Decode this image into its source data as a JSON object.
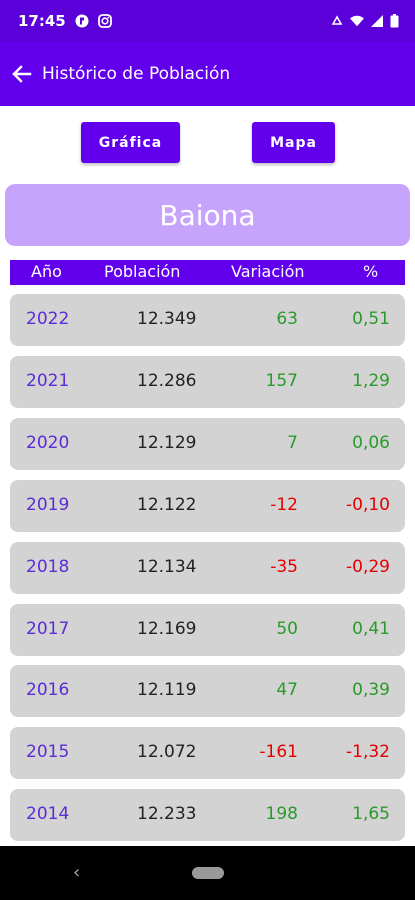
{
  "status_bar": {
    "time": "17:45"
  },
  "app_bar": {
    "title": "Histórico de Población"
  },
  "buttons": {
    "grafica": "Gráfica",
    "mapa": "Mapa"
  },
  "place": "Baiona",
  "table": {
    "headers": {
      "anio": "Año",
      "poblacion": "Población",
      "variacion": "Variación",
      "pct": "%"
    },
    "rows": [
      {
        "year": "2022",
        "population": "12.349",
        "variation": "63",
        "pct": "0,51",
        "trend": "pos"
      },
      {
        "year": "2021",
        "population": "12.286",
        "variation": "157",
        "pct": "1,29",
        "trend": "pos"
      },
      {
        "year": "2020",
        "population": "12.129",
        "variation": "7",
        "pct": "0,06",
        "trend": "pos"
      },
      {
        "year": "2019",
        "population": "12.122",
        "variation": "-12",
        "pct": "-0,10",
        "trend": "neg"
      },
      {
        "year": "2018",
        "population": "12.134",
        "variation": "-35",
        "pct": "-0,29",
        "trend": "neg"
      },
      {
        "year": "2017",
        "population": "12.169",
        "variation": "50",
        "pct": "0,41",
        "trend": "pos"
      },
      {
        "year": "2016",
        "population": "12.119",
        "variation": "47",
        "pct": "0,39",
        "trend": "pos"
      },
      {
        "year": "2015",
        "population": "12.072",
        "variation": "-161",
        "pct": "-1,32",
        "trend": "neg"
      },
      {
        "year": "2014",
        "population": "12.233",
        "variation": "198",
        "pct": "1,65",
        "trend": "pos"
      }
    ]
  },
  "colors": {
    "primary": "#6200ee",
    "status_bar": "#5b00d9",
    "banner": "#c6a4fb",
    "positive": "#2a9a2a",
    "negative": "#e60000"
  }
}
